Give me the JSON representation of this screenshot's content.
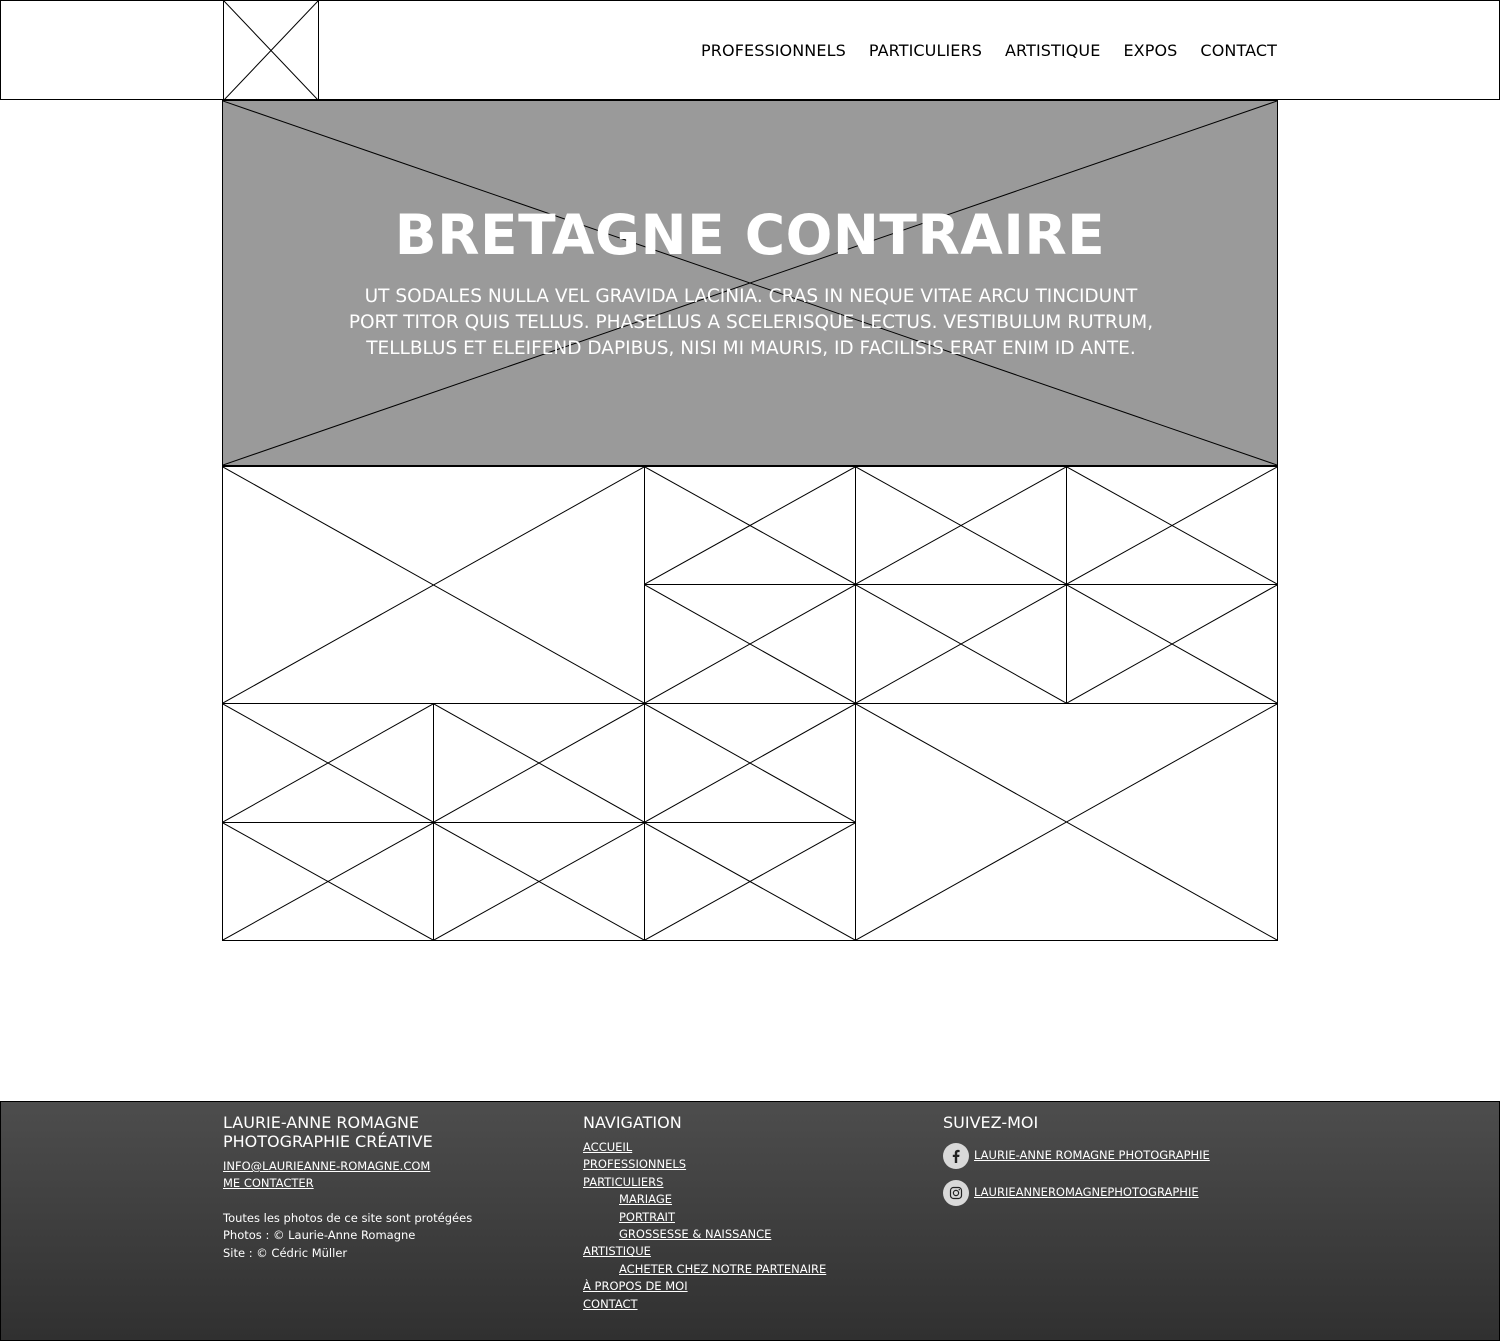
{
  "header": {
    "logo_icon": "image-placeholder-icon",
    "nav": [
      "PROFESSIONNELS",
      "PARTICULIERS",
      "ARTISTIQUE",
      "EXPOS",
      "CONTACT"
    ]
  },
  "hero": {
    "title": "BRETAGNE CONTRAIRE",
    "text_lines": [
      "UT SODALES NULLA VEL GRAVIDA LACINIA. CRAS IN NEQUE VITAE ARCU TINCIDUNT",
      "PORT TITOR QUIS TELLUS. PHASELLUS A SCELERISQUE LECTUS. VESTIBULUM RUTRUM,",
      "TELLBLUS ET ELEIFEND DAPIBUS, NISI MI MAURIS, ID FACILISIS ERAT ENIM ID ANTE."
    ],
    "background": "#9a9a9a"
  },
  "footer": {
    "col1": {
      "title_line1": "LAURIE-ANNE ROMAGNE",
      "title_line2": "PHOTOGRAPHIE CRÉATIVE",
      "email": "INFO@LAURIEANNE-ROMAGNE.COM",
      "contact_link": "ME CONTACTER",
      "copyright": [
        "Toutes les photos de ce site sont protégées",
        "Photos : © Laurie-Anne Romagne",
        "Site : © Cédric Müller"
      ]
    },
    "col2": {
      "title": "NAVIGATION",
      "items": [
        {
          "label": "ACCUEIL",
          "level": 0
        },
        {
          "label": "PROFESSIONNELS",
          "level": 0
        },
        {
          "label": "PARTICULIERS",
          "level": 0
        },
        {
          "label": "MARIAGE",
          "level": 1
        },
        {
          "label": "PORTRAIT",
          "level": 1
        },
        {
          "label": "GROSSESSE & NAISSANCE",
          "level": 1
        },
        {
          "label": "ARTISTIQUE",
          "level": 0
        },
        {
          "label": "ACHETER CHEZ NOTRE PARTENAIRE",
          "level": 1
        },
        {
          "label": "À PROPOS DE MOI",
          "level": 0
        },
        {
          "label": "CONTACT",
          "level": 0
        }
      ]
    },
    "col3": {
      "title": "SUIVEZ-MOI",
      "facebook": {
        "icon": "facebook-icon",
        "label": "LAURIE-ANNE ROMAGNE PHOTOGRAPHIE"
      },
      "instagram": {
        "icon": "instagram-icon",
        "label": "LAURIEANNEROMAGNEPHOTOGRAPHIE"
      }
    }
  }
}
